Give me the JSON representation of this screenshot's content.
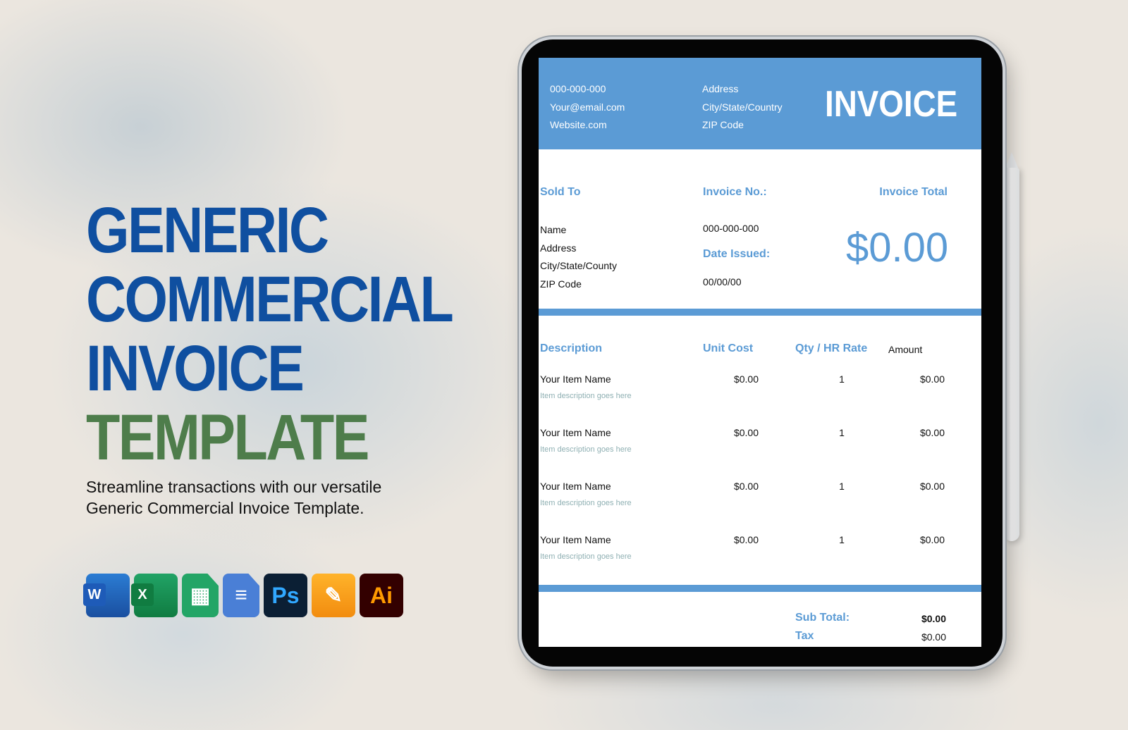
{
  "headline": {
    "lines": [
      "GENERIC",
      "COMMERCIAL",
      "INVOICE",
      "TEMPLATE"
    ],
    "colors": {
      "primary": "#0f4fa0",
      "accent": "#4e7d4b"
    }
  },
  "subtitle": [
    "Streamline transactions with our versatile",
    "Generic Commercial Invoice Template."
  ],
  "apps": [
    {
      "name": "word-icon",
      "label": "W"
    },
    {
      "name": "excel-icon",
      "label": "X"
    },
    {
      "name": "google-sheets-icon",
      "label": "▦"
    },
    {
      "name": "google-docs-icon",
      "label": "≡"
    },
    {
      "name": "photoshop-icon",
      "label": "Ps"
    },
    {
      "name": "pages-icon",
      "label": "✎"
    },
    {
      "name": "illustrator-icon",
      "label": "Ai"
    }
  ],
  "invoice": {
    "accent_color": "#5b9bd5",
    "title": "INVOICE",
    "contact": [
      "000-000-000",
      "Your@email.com",
      "Website.com"
    ],
    "address": [
      "Address",
      "City/State/Country",
      "ZIP Code"
    ],
    "sold_to": {
      "label": "Sold To",
      "lines": [
        "Name",
        "Address",
        "City/State/County",
        "ZIP Code"
      ]
    },
    "invoice_no": {
      "label": "Invoice No.:",
      "value": "000-000-000"
    },
    "date_issued": {
      "label": "Date Issued:",
      "value": "00/00/00"
    },
    "invoice_total": {
      "label": "Invoice Total",
      "value": "$0.00"
    },
    "columns": [
      "Description",
      "Unit Cost",
      "Qty / HR Rate",
      "Amount"
    ],
    "items": [
      {
        "name": "Your Item Name",
        "desc": "Item description goes here",
        "unit_cost": "$0.00",
        "qty": "1",
        "amount": "$0.00"
      },
      {
        "name": "Your Item Name",
        "desc": "Item description goes here",
        "unit_cost": "$0.00",
        "qty": "1",
        "amount": "$0.00"
      },
      {
        "name": "Your Item Name",
        "desc": "Item description goes here",
        "unit_cost": "$0.00",
        "qty": "1",
        "amount": "$0.00"
      },
      {
        "name": "Your Item Name",
        "desc": "Item description goes here",
        "unit_cost": "$0.00",
        "qty": "1",
        "amount": "$0.00"
      }
    ],
    "subtotal": {
      "label": "Sub Total:",
      "value": "$0.00"
    },
    "tax": {
      "label": "Tax",
      "value": "$0.00"
    }
  }
}
